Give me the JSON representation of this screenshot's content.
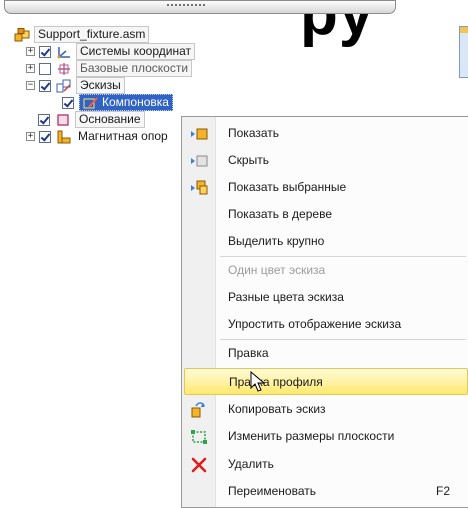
{
  "header": {
    "big_text": "py"
  },
  "tree": {
    "items": [
      {
        "label": "Support_fixture.asm",
        "icon": "assembly-icon",
        "expander": "",
        "checked": null
      },
      {
        "label": "Системы координат",
        "icon": "coordinate-systems-icon",
        "expander": "+",
        "checked": true
      },
      {
        "label": "Базовые плоскости",
        "icon": "base-planes-icon",
        "expander": "+",
        "checked": false
      },
      {
        "label": "Эскизы",
        "icon": "sketches-icon",
        "expander": "−",
        "checked": true
      },
      {
        "label": "Компоновка",
        "icon": "layout-sketch-icon",
        "expander": "",
        "checked": true,
        "selected": true
      },
      {
        "label": "Основание",
        "icon": "part-icon",
        "expander": "",
        "checked": true
      },
      {
        "label": "Магнитная опор",
        "icon": "subassembly-icon",
        "expander": "+",
        "checked": true
      }
    ]
  },
  "context_menu": {
    "items": [
      {
        "label": "Показать",
        "icon": "show-icon"
      },
      {
        "label": "Скрыть",
        "icon": "hide-icon"
      },
      {
        "label": "Показать выбранные",
        "icon": "show-selected-icon"
      },
      {
        "label": "Показать в дереве",
        "icon": ""
      },
      {
        "label": "Выделить крупно",
        "icon": ""
      },
      {
        "label": "Один цвет эскиза",
        "icon": "",
        "disabled": true
      },
      {
        "label": "Разные цвета эскиза",
        "icon": ""
      },
      {
        "label": "Упростить отображение эскиза",
        "icon": ""
      },
      {
        "label": "Правка",
        "icon": ""
      },
      {
        "label": "Правка профиля",
        "icon": "",
        "hover": true
      },
      {
        "label": "Копировать эскиз",
        "icon": "copy-sketch-icon"
      },
      {
        "label": "Изменить размеры плоскости",
        "icon": "resize-plane-icon"
      },
      {
        "label": "Удалить",
        "icon": "delete-icon"
      },
      {
        "label": "Переименовать",
        "icon": "",
        "shortcut": "F2"
      }
    ]
  },
  "colors": {
    "selection": "#3163c5",
    "hover_fill": "#fff19c",
    "delete_red": "#e01b1b"
  }
}
